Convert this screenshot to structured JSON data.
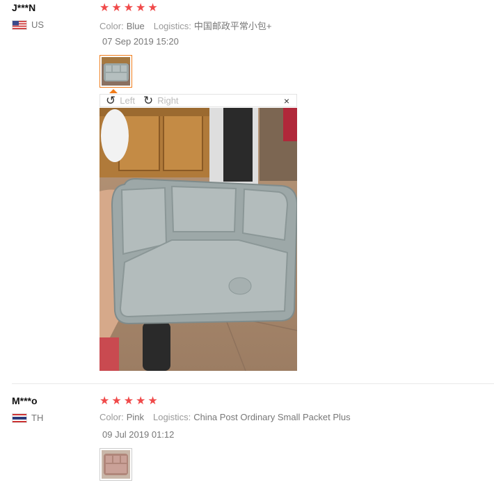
{
  "reviews": [
    {
      "user": "J***N",
      "country": "US",
      "stars": 5,
      "color_label": "Color:",
      "color_value": "Blue",
      "logistics_label": "Logistics:",
      "logistics_value": "中国邮政平常小包+",
      "date": "07 Sep 2019 15:20"
    },
    {
      "user": "M***o",
      "country": "TH",
      "stars": 5,
      "color_label": "Color:",
      "color_value": "Pink",
      "logistics_label": "Logistics:",
      "logistics_value": "China Post Ordinary Small Packet Plus",
      "date": "09 Jul 2019 01:12"
    }
  ],
  "viewer": {
    "rotate_left": "Left",
    "rotate_right": "Right",
    "close": "×"
  },
  "colors": {
    "star": "#f04a4a",
    "active_thumb_border": "#f07c1a"
  }
}
